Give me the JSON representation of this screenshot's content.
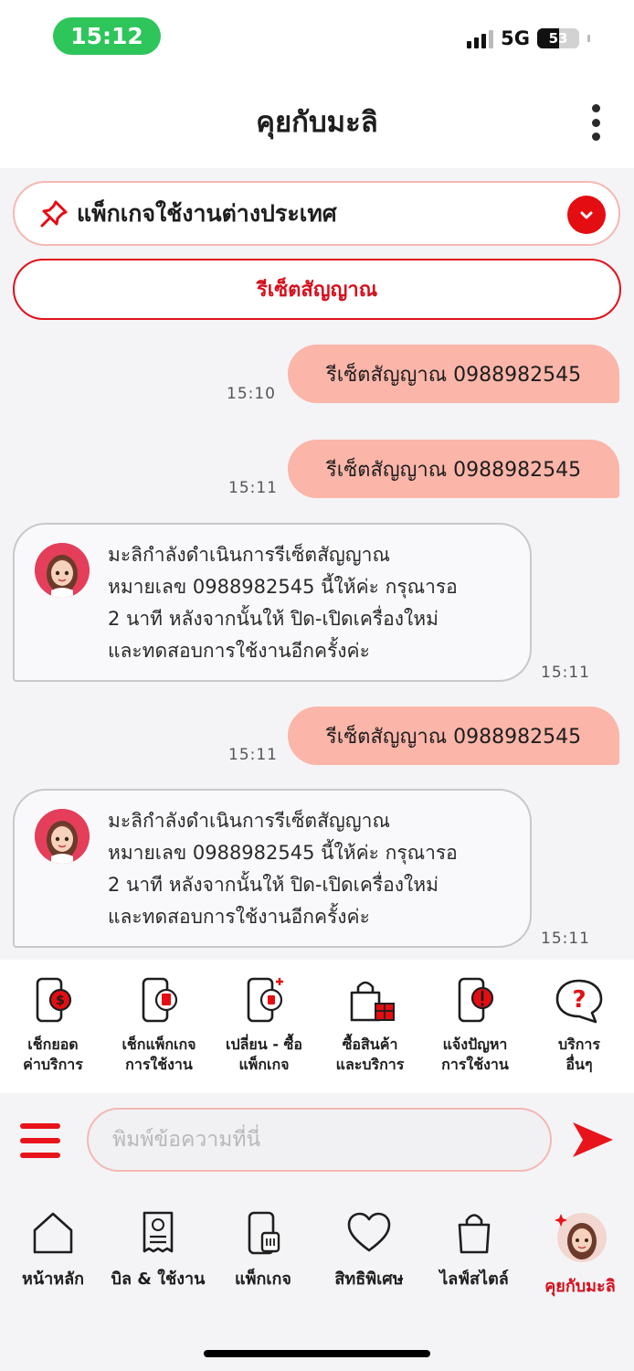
{
  "status_bar": {
    "time": "15:12",
    "network": "5G",
    "battery": "53",
    "battery_level": 0.53
  },
  "header": {
    "title": "คุยกับมะลิ"
  },
  "pinned": {
    "label": "แพ็กเกจใช้งานต่างประเทศ"
  },
  "quick_reply": {
    "label": "รีเซ็ตสัญญาณ"
  },
  "messages": [
    {
      "from": "user",
      "text": "รีเซ็ตสัญญาณ 0988982545",
      "time": "15:10"
    },
    {
      "from": "user",
      "text": "รีเซ็ตสัญญาณ 0988982545",
      "time": "15:11"
    },
    {
      "from": "bot",
      "text": "มะลิกำลังดำเนินการรีเซ็ตสัญญาณ\nหมายเลข 0988982545 นี้ให้ค่ะ กรุณารอ\n2 นาที หลังจากนั้นให้ ปิด-เปิดเครื่องใหม่\nและทดสอบการใช้งานอีกครั้งค่ะ",
      "time": "15:11"
    },
    {
      "from": "user",
      "text": "รีเซ็ตสัญญาณ 0988982545",
      "time": "15:11"
    },
    {
      "from": "bot",
      "text": "มะลิกำลังดำเนินการรีเซ็ตสัญญาณ\nหมายเลข 0988982545 นี้ให้ค่ะ กรุณารอ\n2 นาที หลังจากนั้นให้ ปิด-เปิดเครื่องใหม่\nและทดสอบการใช้งานอีกครั้งค่ะ",
      "time": "15:11"
    }
  ],
  "quick_actions": [
    {
      "label": "เช็กยอด\nค่าบริการ",
      "icon": "phone-bill-icon"
    },
    {
      "label": "เช็กแพ็กเกจ\nการใช้งาน",
      "icon": "phone-sim-icon"
    },
    {
      "label": "เปลี่ยน - ซื้อ\nแพ็กเกจ",
      "icon": "phone-swap-icon"
    },
    {
      "label": "ซื้อสินค้า\nและบริการ",
      "icon": "shopping-gift-icon"
    },
    {
      "label": "แจ้งปัญหา\nการใช้งาน",
      "icon": "phone-alert-icon"
    },
    {
      "label": "บริการ\nอื่นๆ",
      "icon": "question-bubble-icon"
    }
  ],
  "composer": {
    "placeholder": "พิมพ์ข้อความที่นี่"
  },
  "tabs": [
    {
      "label": "หน้าหลัก",
      "icon": "home-icon"
    },
    {
      "label": "บิล & ใช้งาน",
      "icon": "bill-icon"
    },
    {
      "label": "แพ็กเกจ",
      "icon": "package-icon"
    },
    {
      "label": "สิทธิพิเศษ",
      "icon": "heart-icon"
    },
    {
      "label": "ไลฟ์สไตล์",
      "icon": "shopping-bag-icon"
    },
    {
      "label": "คุยกับมะลิ",
      "icon": "mali-avatar-icon",
      "active": true
    }
  ],
  "colors": {
    "brand_red": "#e40d12",
    "user_bubble": "#fbb5a9",
    "online_green": "#2ec55a"
  }
}
